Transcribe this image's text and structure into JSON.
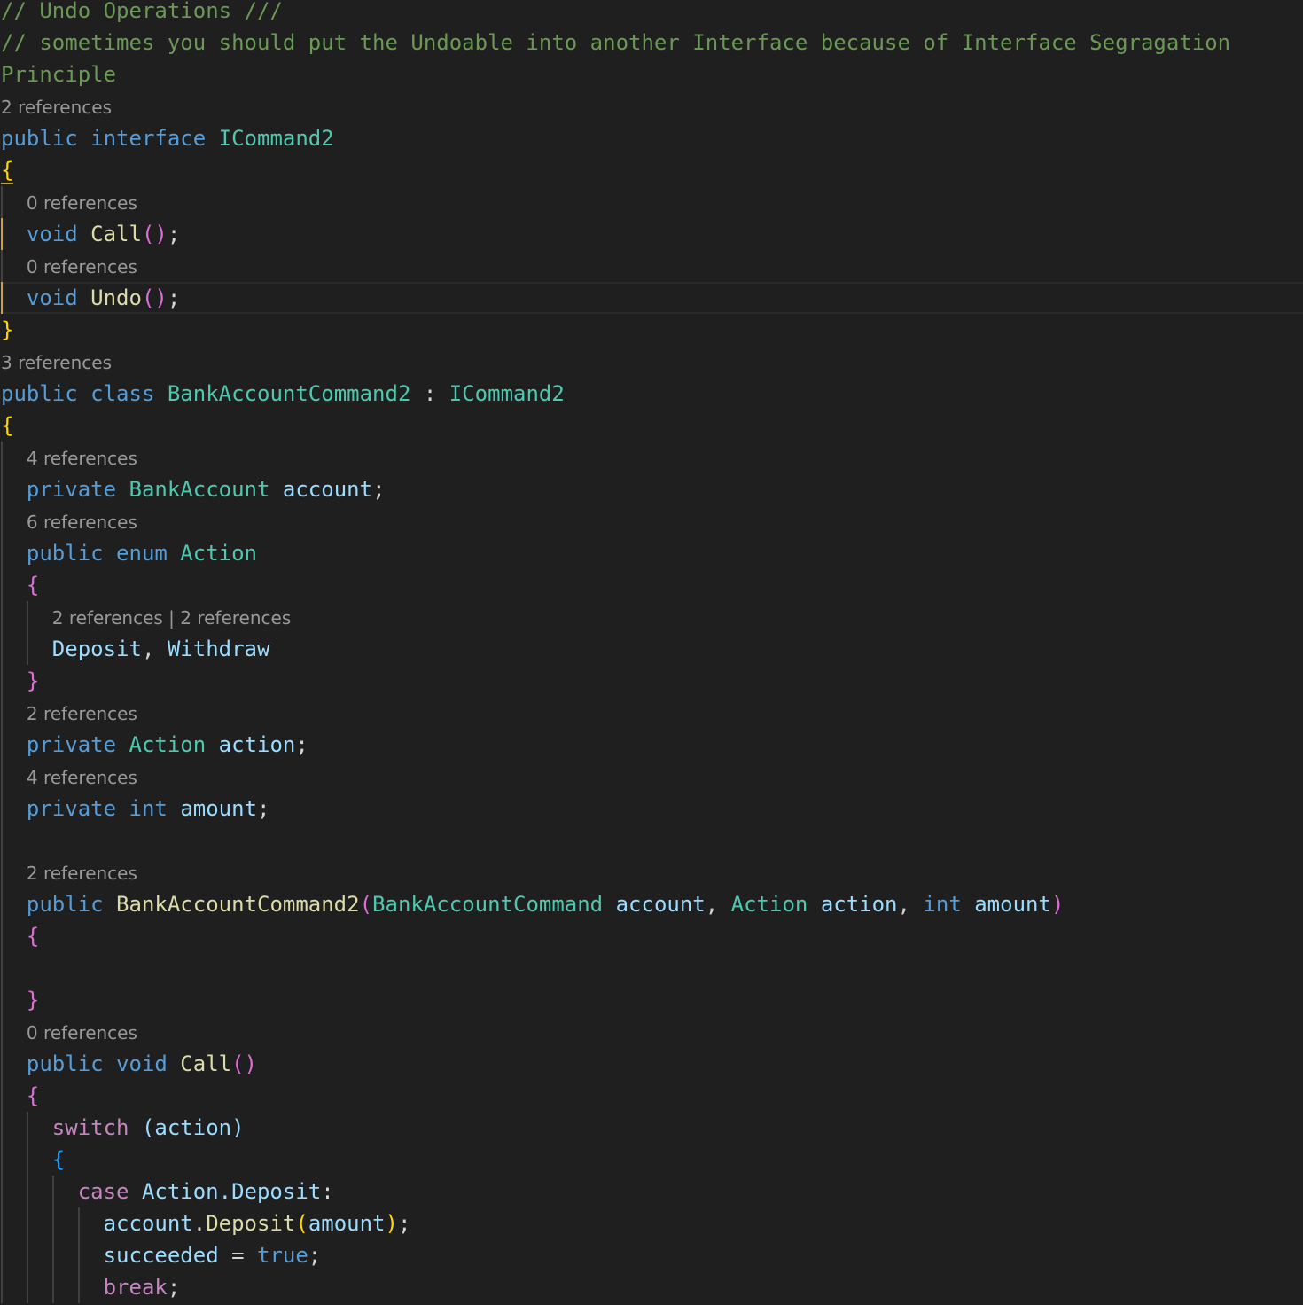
{
  "editor": {
    "language": "csharp",
    "theme_colors": {
      "background": "#1f1f1f",
      "keyword": "#569cd6",
      "type": "#4ec9b0",
      "function": "#dcdcaa",
      "variable": "#9cdcfe",
      "control": "#c586c0",
      "comment": "#6a9955",
      "codelens": "#999999"
    },
    "current_line": 9
  },
  "lines": [
    {
      "kind": "code",
      "indent": 0,
      "tokens": [
        [
          "// Undo Operations ///",
          "cm"
        ]
      ]
    },
    {
      "kind": "code",
      "indent": 0,
      "tokens": [
        [
          "// sometimes you should put the Undoable into another Interface because of Interface Segragation",
          "cm"
        ]
      ]
    },
    {
      "kind": "code",
      "indent": 0,
      "tokens": [
        [
          "Principle",
          "cm"
        ]
      ]
    },
    {
      "kind": "lens",
      "indent": 0,
      "tokens": [
        [
          "2 references",
          "lens"
        ]
      ]
    },
    {
      "kind": "code",
      "indent": 0,
      "tokens": [
        [
          "public",
          "kw"
        ],
        [
          " ",
          "pu"
        ],
        [
          "interface",
          "kw"
        ],
        [
          " ",
          "pu"
        ],
        [
          "ICommand2",
          "ty"
        ]
      ]
    },
    {
      "kind": "code",
      "indent": 0,
      "tokens": [
        [
          "{",
          "b1u"
        ]
      ]
    },
    {
      "kind": "lens",
      "indent": 1,
      "tokens": [
        [
          "0 references",
          "lens"
        ]
      ]
    },
    {
      "kind": "code",
      "indent": 1,
      "active": true,
      "tokens": [
        [
          "void",
          "kw"
        ],
        [
          " ",
          "pu"
        ],
        [
          "Call",
          "fn"
        ],
        [
          "()",
          "b2"
        ],
        [
          ";",
          "pu"
        ]
      ]
    },
    {
      "kind": "lens",
      "indent": 1,
      "tokens": [
        [
          "0 references",
          "lens"
        ]
      ]
    },
    {
      "kind": "code",
      "indent": 1,
      "active": true,
      "tokens": [
        [
          "void",
          "kw"
        ],
        [
          " ",
          "pu"
        ],
        [
          "Undo",
          "fn"
        ],
        [
          "()",
          "b2"
        ],
        [
          ";",
          "pu"
        ]
      ]
    },
    {
      "kind": "code",
      "indent": 0,
      "tokens": [
        [
          "}",
          "b1"
        ]
      ]
    },
    {
      "kind": "lens",
      "indent": 0,
      "tokens": [
        [
          "3 references",
          "lens"
        ]
      ]
    },
    {
      "kind": "code",
      "indent": 0,
      "tokens": [
        [
          "public",
          "kw"
        ],
        [
          " ",
          "pu"
        ],
        [
          "class",
          "kw"
        ],
        [
          " ",
          "pu"
        ],
        [
          "BankAccountCommand2",
          "ty"
        ],
        [
          " : ",
          "pu"
        ],
        [
          "ICommand2",
          "ty"
        ]
      ]
    },
    {
      "kind": "code",
      "indent": 0,
      "tokens": [
        [
          "{",
          "b1"
        ]
      ]
    },
    {
      "kind": "lens",
      "indent": 1,
      "tokens": [
        [
          "4 references",
          "lens"
        ]
      ]
    },
    {
      "kind": "code",
      "indent": 1,
      "tokens": [
        [
          "private",
          "kw"
        ],
        [
          " ",
          "pu"
        ],
        [
          "BankAccount",
          "ty"
        ],
        [
          " ",
          "pu"
        ],
        [
          "account",
          "va"
        ],
        [
          ";",
          "pu"
        ]
      ]
    },
    {
      "kind": "lens",
      "indent": 1,
      "tokens": [
        [
          "6 references",
          "lens"
        ]
      ]
    },
    {
      "kind": "code",
      "indent": 1,
      "tokens": [
        [
          "public",
          "kw"
        ],
        [
          " ",
          "pu"
        ],
        [
          "enum",
          "kw"
        ],
        [
          " ",
          "pu"
        ],
        [
          "Action",
          "ty"
        ]
      ]
    },
    {
      "kind": "code",
      "indent": 1,
      "tokens": [
        [
          "{",
          "b2"
        ]
      ]
    },
    {
      "kind": "lens",
      "indent": 2,
      "tokens": [
        [
          "2 references | 2 references",
          "lens"
        ]
      ]
    },
    {
      "kind": "code",
      "indent": 2,
      "tokens": [
        [
          "Deposit",
          "va"
        ],
        [
          ", ",
          "pu"
        ],
        [
          "Withdraw",
          "va"
        ]
      ]
    },
    {
      "kind": "code",
      "indent": 1,
      "tokens": [
        [
          "}",
          "b2"
        ]
      ]
    },
    {
      "kind": "lens",
      "indent": 1,
      "tokens": [
        [
          "2 references",
          "lens"
        ]
      ]
    },
    {
      "kind": "code",
      "indent": 1,
      "tokens": [
        [
          "private",
          "kw"
        ],
        [
          " ",
          "pu"
        ],
        [
          "Action",
          "ty"
        ],
        [
          " ",
          "pu"
        ],
        [
          "action",
          "va"
        ],
        [
          ";",
          "pu"
        ]
      ]
    },
    {
      "kind": "lens",
      "indent": 1,
      "tokens": [
        [
          "4 references",
          "lens"
        ]
      ]
    },
    {
      "kind": "code",
      "indent": 1,
      "tokens": [
        [
          "private",
          "kw"
        ],
        [
          " ",
          "pu"
        ],
        [
          "int",
          "kw"
        ],
        [
          " ",
          "pu"
        ],
        [
          "amount",
          "va"
        ],
        [
          ";",
          "pu"
        ]
      ]
    },
    {
      "kind": "code",
      "indent": 1,
      "tokens": []
    },
    {
      "kind": "lens",
      "indent": 1,
      "tokens": [
        [
          "2 references",
          "lens"
        ]
      ]
    },
    {
      "kind": "code",
      "indent": 1,
      "tokens": [
        [
          "public",
          "kw"
        ],
        [
          " ",
          "pu"
        ],
        [
          "BankAccountCommand2",
          "fn"
        ],
        [
          "(",
          "b2"
        ],
        [
          "BankAccountCommand",
          "ty"
        ],
        [
          " ",
          "pu"
        ],
        [
          "account",
          "va"
        ],
        [
          ", ",
          "pu"
        ],
        [
          "Action",
          "ty"
        ],
        [
          " ",
          "pu"
        ],
        [
          "action",
          "va"
        ],
        [
          ", ",
          "pu"
        ],
        [
          "int",
          "kw"
        ],
        [
          " ",
          "pu"
        ],
        [
          "amount",
          "va"
        ],
        [
          ")",
          "b2"
        ]
      ]
    },
    {
      "kind": "code",
      "indent": 1,
      "tokens": [
        [
          "{",
          "b2"
        ]
      ]
    },
    {
      "kind": "code",
      "indent": 1,
      "tokens": []
    },
    {
      "kind": "code",
      "indent": 1,
      "tokens": [
        [
          "}",
          "b2"
        ]
      ]
    },
    {
      "kind": "lens",
      "indent": 1,
      "tokens": [
        [
          "0 references",
          "lens"
        ]
      ]
    },
    {
      "kind": "code",
      "indent": 1,
      "tokens": [
        [
          "public",
          "kw"
        ],
        [
          " ",
          "pu"
        ],
        [
          "void",
          "kw"
        ],
        [
          " ",
          "pu"
        ],
        [
          "Call",
          "fn"
        ],
        [
          "()",
          "b2"
        ]
      ]
    },
    {
      "kind": "code",
      "indent": 1,
      "tokens": [
        [
          "{",
          "b2"
        ]
      ]
    },
    {
      "kind": "code",
      "indent": 2,
      "tokens": [
        [
          "switch",
          "ct"
        ],
        [
          " ",
          "pu"
        ],
        [
          "(action)",
          "va"
        ]
      ]
    },
    {
      "kind": "code",
      "indent": 2,
      "tokens": [
        [
          "{",
          "b3"
        ]
      ]
    },
    {
      "kind": "code",
      "indent": 3,
      "tokens": [
        [
          "case",
          "ct"
        ],
        [
          " ",
          "pu"
        ],
        [
          "Action.Deposit",
          "va"
        ],
        [
          ":",
          "pu"
        ]
      ]
    },
    {
      "kind": "code",
      "indent": 4,
      "tokens": [
        [
          "account",
          "va"
        ],
        [
          ".",
          "pu"
        ],
        [
          "Deposit",
          "fn"
        ],
        [
          "(",
          "b1"
        ],
        [
          "amount",
          "va"
        ],
        [
          ")",
          "b1"
        ],
        [
          ";",
          "pu"
        ]
      ]
    },
    {
      "kind": "code",
      "indent": 4,
      "tokens": [
        [
          "succeeded",
          "va"
        ],
        [
          " = ",
          "pu"
        ],
        [
          "true",
          "kw"
        ],
        [
          ";",
          "pu"
        ]
      ]
    },
    {
      "kind": "code",
      "indent": 4,
      "tokens": [
        [
          "break",
          "ct"
        ],
        [
          ";",
          "pu"
        ]
      ]
    }
  ]
}
